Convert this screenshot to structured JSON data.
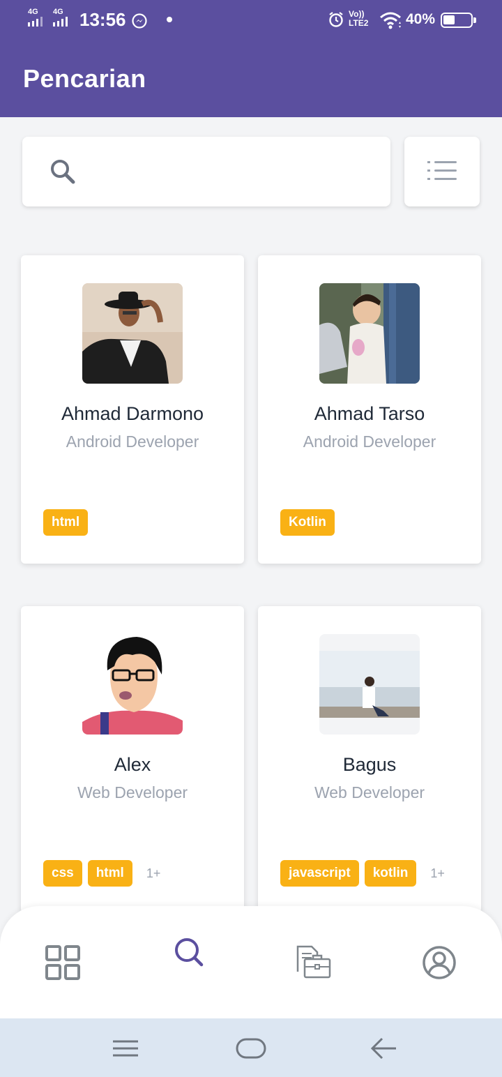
{
  "status_bar": {
    "network_1": "4G",
    "network_2": "4G",
    "time": "13:56",
    "volte_top": "Vo))",
    "volte_bottom": "LTE2",
    "battery": "40%"
  },
  "app_bar": {
    "title": "Pencarian"
  },
  "search": {
    "value": "",
    "placeholder": ""
  },
  "profiles": [
    {
      "name": "Ahmad Darmono",
      "role": "Android Developer",
      "tags": [
        "html"
      ],
      "more": ""
    },
    {
      "name": "Ahmad Tarso",
      "role": "Android Developer",
      "tags": [
        "Kotlin"
      ],
      "more": ""
    },
    {
      "name": "Alex",
      "role": "Web Developer",
      "tags": [
        "css",
        "html"
      ],
      "more": "1+"
    },
    {
      "name": "Bagus",
      "role": "Web Developer",
      "tags": [
        "javascript",
        "kotlin"
      ],
      "more": "1+"
    }
  ],
  "bottom_nav": {
    "active": "search",
    "items": [
      "dashboard-icon",
      "search-icon",
      "portfolio-icon",
      "profile-icon"
    ]
  },
  "colors": {
    "primary": "#5b4f9f",
    "tag": "#f9b115",
    "muted": "#9ca3af",
    "nav_inactive": "#7f868c"
  }
}
